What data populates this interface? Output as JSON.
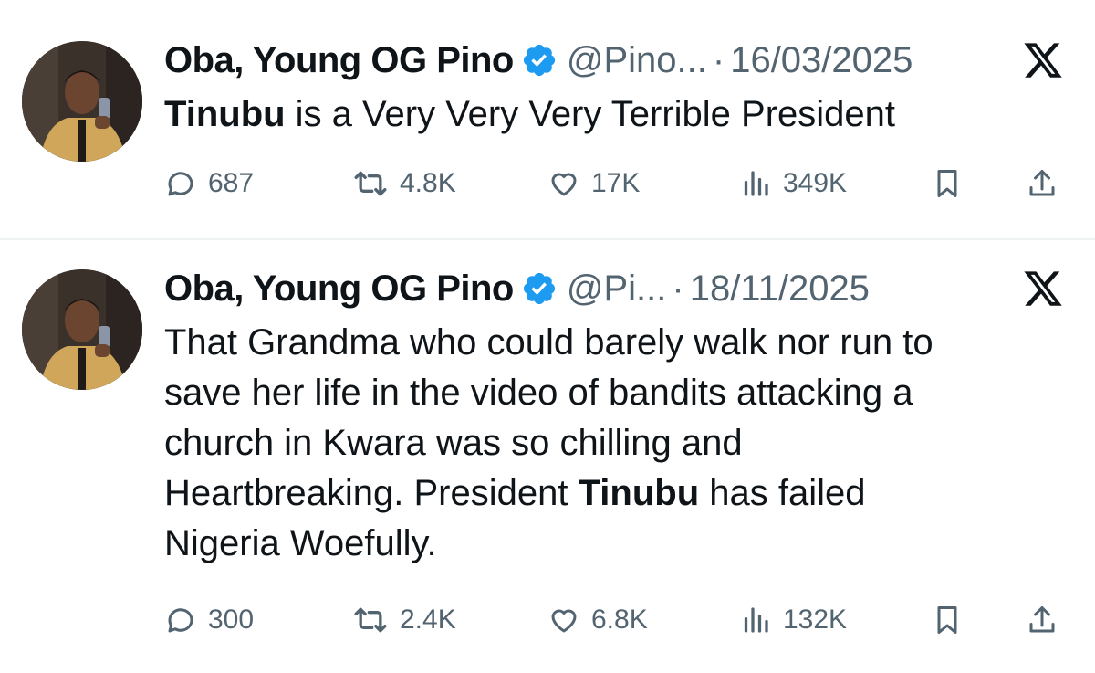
{
  "colors": {
    "text": "#0f1419",
    "secondary": "#536471",
    "verified": "#1d9bf0",
    "divider": "#eff3f4"
  },
  "tweets": [
    {
      "author": "Oba, Young OG Pino",
      "handle": "@Pino...",
      "separator": "·",
      "date": "16/03/2025",
      "text_parts": [
        {
          "text": "Tinubu",
          "bold": true
        },
        {
          "text": " is a Very Very Very Terrible President",
          "bold": false
        }
      ],
      "stats": {
        "replies": "687",
        "reposts": "4.8K",
        "likes": "17K",
        "views": "349K"
      }
    },
    {
      "author": "Oba, Young OG Pino",
      "handle": "@Pi...",
      "separator": "·",
      "date": "18/11/2025",
      "lines": [
        "That Grandma who could barely walk nor run to",
        "save her life in the video of bandits attacking a",
        "church in Kwara was so chilling and"
      ],
      "line4_before": "Heartbreaking. President ",
      "line4_bold": "Tinubu",
      "line4_after": " has failed",
      "line5": "Nigeria Woefully.",
      "stats": {
        "replies": "300",
        "reposts": "2.4K",
        "likes": "6.8K",
        "views": "132K"
      }
    }
  ],
  "icons": {
    "reply": "reply-icon",
    "repost": "repost-icon",
    "like": "like-icon",
    "views": "views-icon",
    "bookmark": "bookmark-icon",
    "share": "share-icon",
    "platform": "x-logo-icon",
    "verified": "verified-badge-icon"
  }
}
